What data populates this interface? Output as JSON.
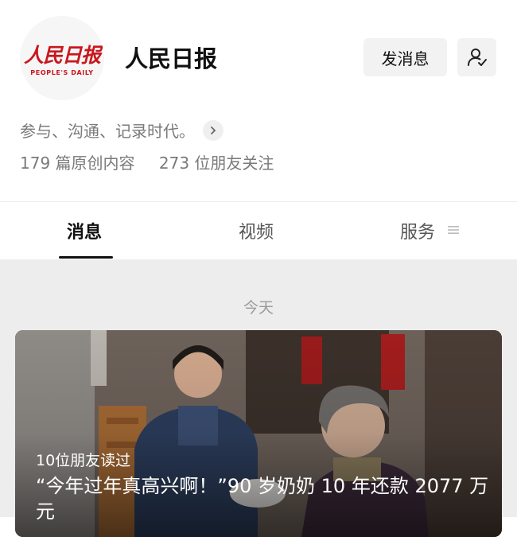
{
  "account": {
    "logo_cn": "人民日报",
    "logo_en": "PEOPLE'S DAILY",
    "name": "人民日报",
    "description": "参与、沟通、记录时代。",
    "stats": {
      "original": "179 篇原创内容",
      "followers": "273 位朋友关注"
    }
  },
  "actions": {
    "message_label": "发消息",
    "follow_icon": "user-check-icon"
  },
  "tabs": [
    {
      "label": "消息",
      "active": true
    },
    {
      "label": "视频",
      "active": false
    },
    {
      "label": "服务",
      "active": false
    }
  ],
  "feed": {
    "date_label": "今天",
    "cards": [
      {
        "read_count": "10位朋友读过",
        "title": "“今年过年真高兴啊！”90 岁奶奶 10 年还款 2077 万元"
      }
    ]
  },
  "colors": {
    "brand_red": "#c9171e",
    "background": "#ededed",
    "button_bg": "#f2f2f2"
  }
}
